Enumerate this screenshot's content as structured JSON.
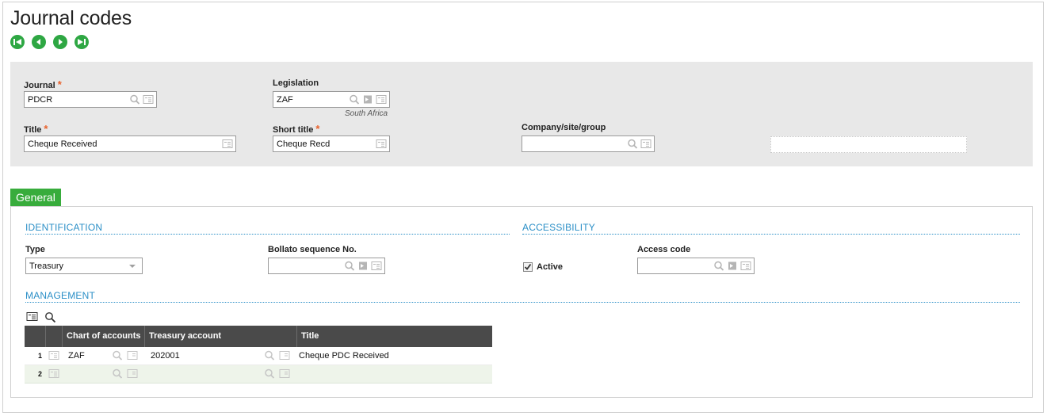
{
  "page": {
    "title": "Journal codes"
  },
  "nav": {
    "first": "first-record",
    "prev": "previous-record",
    "next": "next-record",
    "last": "last-record"
  },
  "header": {
    "journal": {
      "label": "Journal",
      "value": "PDCR"
    },
    "legislation": {
      "label": "Legislation",
      "value": "ZAF",
      "subtitle": "South Africa"
    },
    "title": {
      "label": "Title",
      "value": "Cheque Received"
    },
    "short_title": {
      "label": "Short title",
      "value": "Cheque Recd"
    },
    "company": {
      "label": "Company/site/group",
      "value": ""
    }
  },
  "tabs": [
    {
      "label": "General"
    }
  ],
  "identification": {
    "section": "IDENTIFICATION",
    "type_label": "Type",
    "type_value": "Treasury",
    "bollato_label": "Bollato sequence No.",
    "bollato_value": ""
  },
  "accessibility": {
    "section": "ACCESSIBILITY",
    "active_label": "Active",
    "active_checked": true,
    "access_code_label": "Access code",
    "access_code_value": ""
  },
  "management": {
    "section": "MANAGEMENT",
    "columns": [
      "Chart of accounts",
      "Treasury account",
      "Title"
    ],
    "rows": [
      {
        "num": "1",
        "chart": "ZAF",
        "account": "202001",
        "title": "Cheque PDC Received"
      },
      {
        "num": "2",
        "chart": "",
        "account": "",
        "title": ""
      }
    ]
  },
  "colors": {
    "accent_green": "#38ac3c",
    "section_blue": "#2b8fc7",
    "required_orange": "#e8612c",
    "grid_header": "#4a4a4a"
  }
}
